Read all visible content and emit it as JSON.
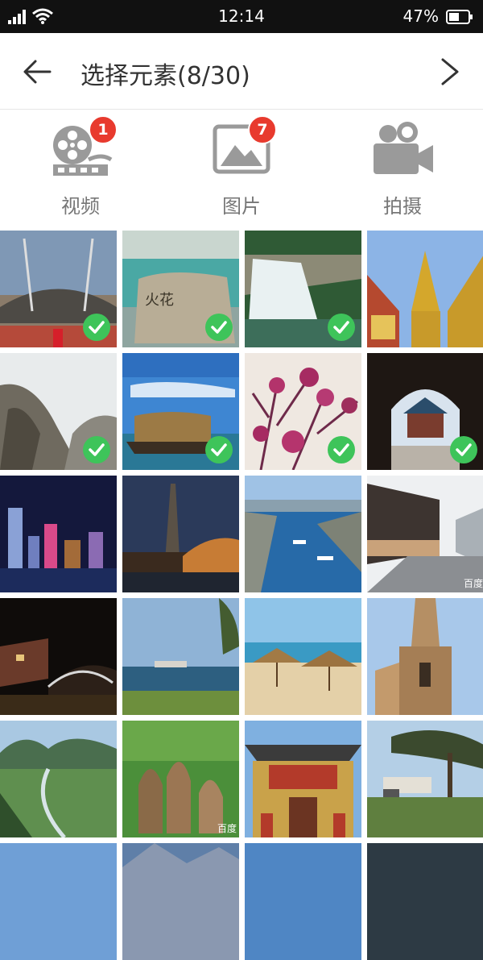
{
  "status_bar": {
    "time": "12:14",
    "battery": "47%"
  },
  "header": {
    "title": "选择元素(8/30)"
  },
  "tabs": [
    {
      "label": "视频",
      "badge": "1",
      "icon": "film-reel-icon"
    },
    {
      "label": "图片",
      "badge": "7",
      "icon": "image-icon"
    },
    {
      "label": "拍摄",
      "icon": "video-camera-icon"
    }
  ],
  "photos": [
    {
      "scene": "stadium",
      "selected": true
    },
    {
      "scene": "lake-stone",
      "selected": true,
      "stone_text": "火花"
    },
    {
      "scene": "waterfall",
      "selected": true
    },
    {
      "scene": "golden-temple",
      "selected": false
    },
    {
      "scene": "mountains",
      "selected": true
    },
    {
      "scene": "houseboat",
      "selected": true
    },
    {
      "scene": "blossoms",
      "selected": true
    },
    {
      "scene": "temple-arch",
      "selected": true
    },
    {
      "scene": "city-night",
      "selected": false
    },
    {
      "scene": "tower-night",
      "selected": false
    },
    {
      "scene": "harbor",
      "selected": false
    },
    {
      "scene": "street",
      "selected": false,
      "watermark": "百度"
    },
    {
      "scene": "bridge-night",
      "selected": false
    },
    {
      "scene": "lake-tree",
      "selected": false
    },
    {
      "scene": "beach-umbrellas",
      "selected": false
    },
    {
      "scene": "cathedral",
      "selected": false
    },
    {
      "scene": "valley",
      "selected": false
    },
    {
      "scene": "kangaroos",
      "selected": false,
      "watermark": "百度"
    },
    {
      "scene": "pagoda-gate",
      "selected": false
    },
    {
      "scene": "tree-park",
      "selected": false
    },
    {
      "scene": "sky",
      "selected": false
    },
    {
      "scene": "mountain-peak",
      "selected": false
    },
    {
      "scene": "sky2",
      "selected": false
    },
    {
      "scene": "dark",
      "selected": false
    }
  ],
  "colors": {
    "check": "#3ec45a",
    "badge": "#e83a2e",
    "icon_grey": "#9a9a9a"
  }
}
